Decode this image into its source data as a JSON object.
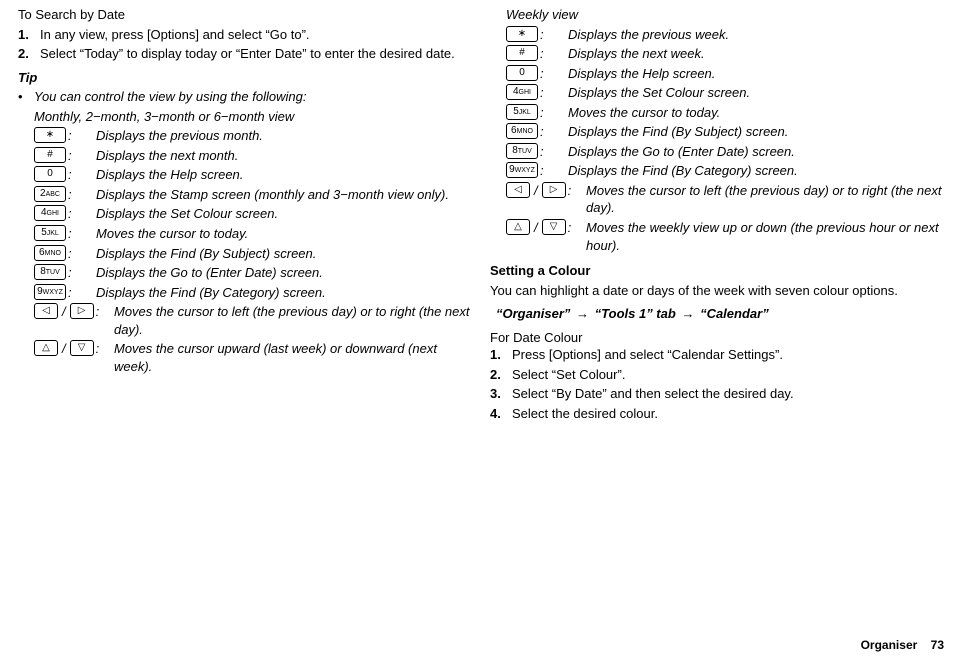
{
  "left": {
    "title": "To Search by Date",
    "steps": [
      {
        "num": "1.",
        "text": "In any view, press [Options] and select “Go to”."
      },
      {
        "num": "2.",
        "text": "Select “Today” to display today or “Enter Date” to enter the desired date."
      }
    ],
    "tipHead": "Tip",
    "tipLine": "You can control the view by using the following:",
    "viewHead": "Monthly, 2−month, 3−month or 6−month view",
    "rows": [
      {
        "key": "∗",
        "sup": "",
        "desc": "Displays the previous month.",
        "name": "key-asterisk"
      },
      {
        "key": "#",
        "sup": "",
        "desc": "Displays the next month.",
        "name": "key-hash"
      },
      {
        "key": "0",
        "sup": "",
        "desc": "Displays the Help screen.",
        "name": "key-0"
      },
      {
        "key": "2",
        "sup": "ABC",
        "desc": "Displays the Stamp screen (monthly and 3−month view only).",
        "name": "key-2"
      },
      {
        "key": "4",
        "sup": "GHI",
        "desc": "Displays the Set Colour screen.",
        "name": "key-4"
      },
      {
        "key": "5",
        "sup": "JKL",
        "desc": "Moves the cursor to today.",
        "name": "key-5"
      },
      {
        "key": "6",
        "sup": "MNO",
        "desc": "Displays the Find (By Subject) screen.",
        "name": "key-6"
      },
      {
        "key": "8",
        "sup": "TUV",
        "desc": "Displays the Go to (Enter Date) screen.",
        "name": "key-8"
      },
      {
        "key": "9",
        "sup": "WXYZ",
        "desc": "Displays the Find (By Category) screen.",
        "name": "key-9"
      }
    ],
    "drows": [
      {
        "k1": "◁",
        "k2": "▷",
        "desc": "Moves the cursor to left (the previous day) or to right (the next day).",
        "name": "key-left-right"
      },
      {
        "k1": "△",
        "k2": "▽",
        "desc": "Moves the cursor upward (last week) or downward (next week).",
        "name": "key-up-down"
      }
    ]
  },
  "right": {
    "viewHead": "Weekly view",
    "rows": [
      {
        "key": "∗",
        "sup": "",
        "desc": "Displays the previous week.",
        "name": "key-asterisk"
      },
      {
        "key": "#",
        "sup": "",
        "desc": "Displays the next week.",
        "name": "key-hash"
      },
      {
        "key": "0",
        "sup": "",
        "desc": "Displays the Help screen.",
        "name": "key-0"
      },
      {
        "key": "4",
        "sup": "GHI",
        "desc": "Displays the Set Colour screen.",
        "name": "key-4"
      },
      {
        "key": "5",
        "sup": "JKL",
        "desc": "Moves the cursor to today.",
        "name": "key-5"
      },
      {
        "key": "6",
        "sup": "MNO",
        "desc": "Displays the Find (By Subject) screen.",
        "name": "key-6"
      },
      {
        "key": "8",
        "sup": "TUV",
        "desc": "Displays the Go to (Enter Date) screen.",
        "name": "key-8"
      },
      {
        "key": "9",
        "sup": "WXYZ",
        "desc": "Displays the Find (By Category) screen.",
        "name": "key-9"
      }
    ],
    "drows": [
      {
        "k1": "◁",
        "k2": "▷",
        "desc": "Moves the cursor to left (the previous day) or to right (the next day).",
        "name": "key-left-right"
      },
      {
        "k1": "△",
        "k2": "▽",
        "desc": "Moves the weekly view up or down (the previous hour or next hour).",
        "name": "key-up-down"
      }
    ],
    "sectionTitle": "Setting a Colour",
    "sectionBody": "You can highlight a date or days of the week with seven colour options.",
    "path": {
      "p1": "“Organiser”",
      "p2": "“Tools 1” tab",
      "p3": "“Calendar”"
    },
    "subhead": "For Date Colour",
    "steps": [
      {
        "num": "1.",
        "text": "Press [Options] and select “Calendar Settings”."
      },
      {
        "num": "2.",
        "text": "Select “Set Colour”."
      },
      {
        "num": "3.",
        "text": "Select “By Date” and then select the desired day."
      },
      {
        "num": "4.",
        "text": "Select the desired colour."
      }
    ]
  },
  "footer": {
    "section": "Organiser",
    "page": "73"
  }
}
